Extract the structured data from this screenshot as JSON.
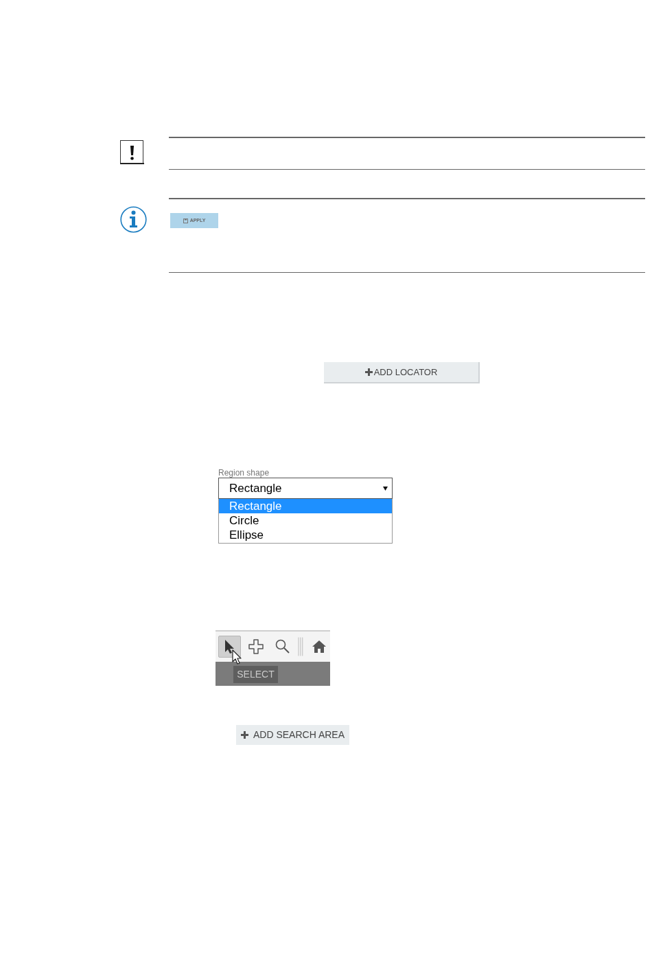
{
  "notices": [
    {
      "kind": "warning"
    },
    {
      "kind": "info",
      "button": {
        "label": "APPLY"
      }
    }
  ],
  "add_locator_button": {
    "label": "ADD LOCATOR"
  },
  "region_shape": {
    "label": "Region shape",
    "value": "Rectangle",
    "expanded": true,
    "options": [
      {
        "label": "Rectangle",
        "selected": true
      },
      {
        "label": "Circle",
        "selected": false
      },
      {
        "label": "Ellipse",
        "selected": false
      }
    ]
  },
  "toolbar": {
    "tools": [
      {
        "kind": "select",
        "selected": true
      },
      {
        "kind": "pan",
        "selected": false
      },
      {
        "kind": "zoom",
        "selected": false
      },
      {
        "kind": "divider"
      },
      {
        "kind": "home",
        "selected": false
      }
    ],
    "tooltip": "SELECT"
  },
  "add_search_area_button": {
    "label": "ADD SEARCH AREA"
  }
}
